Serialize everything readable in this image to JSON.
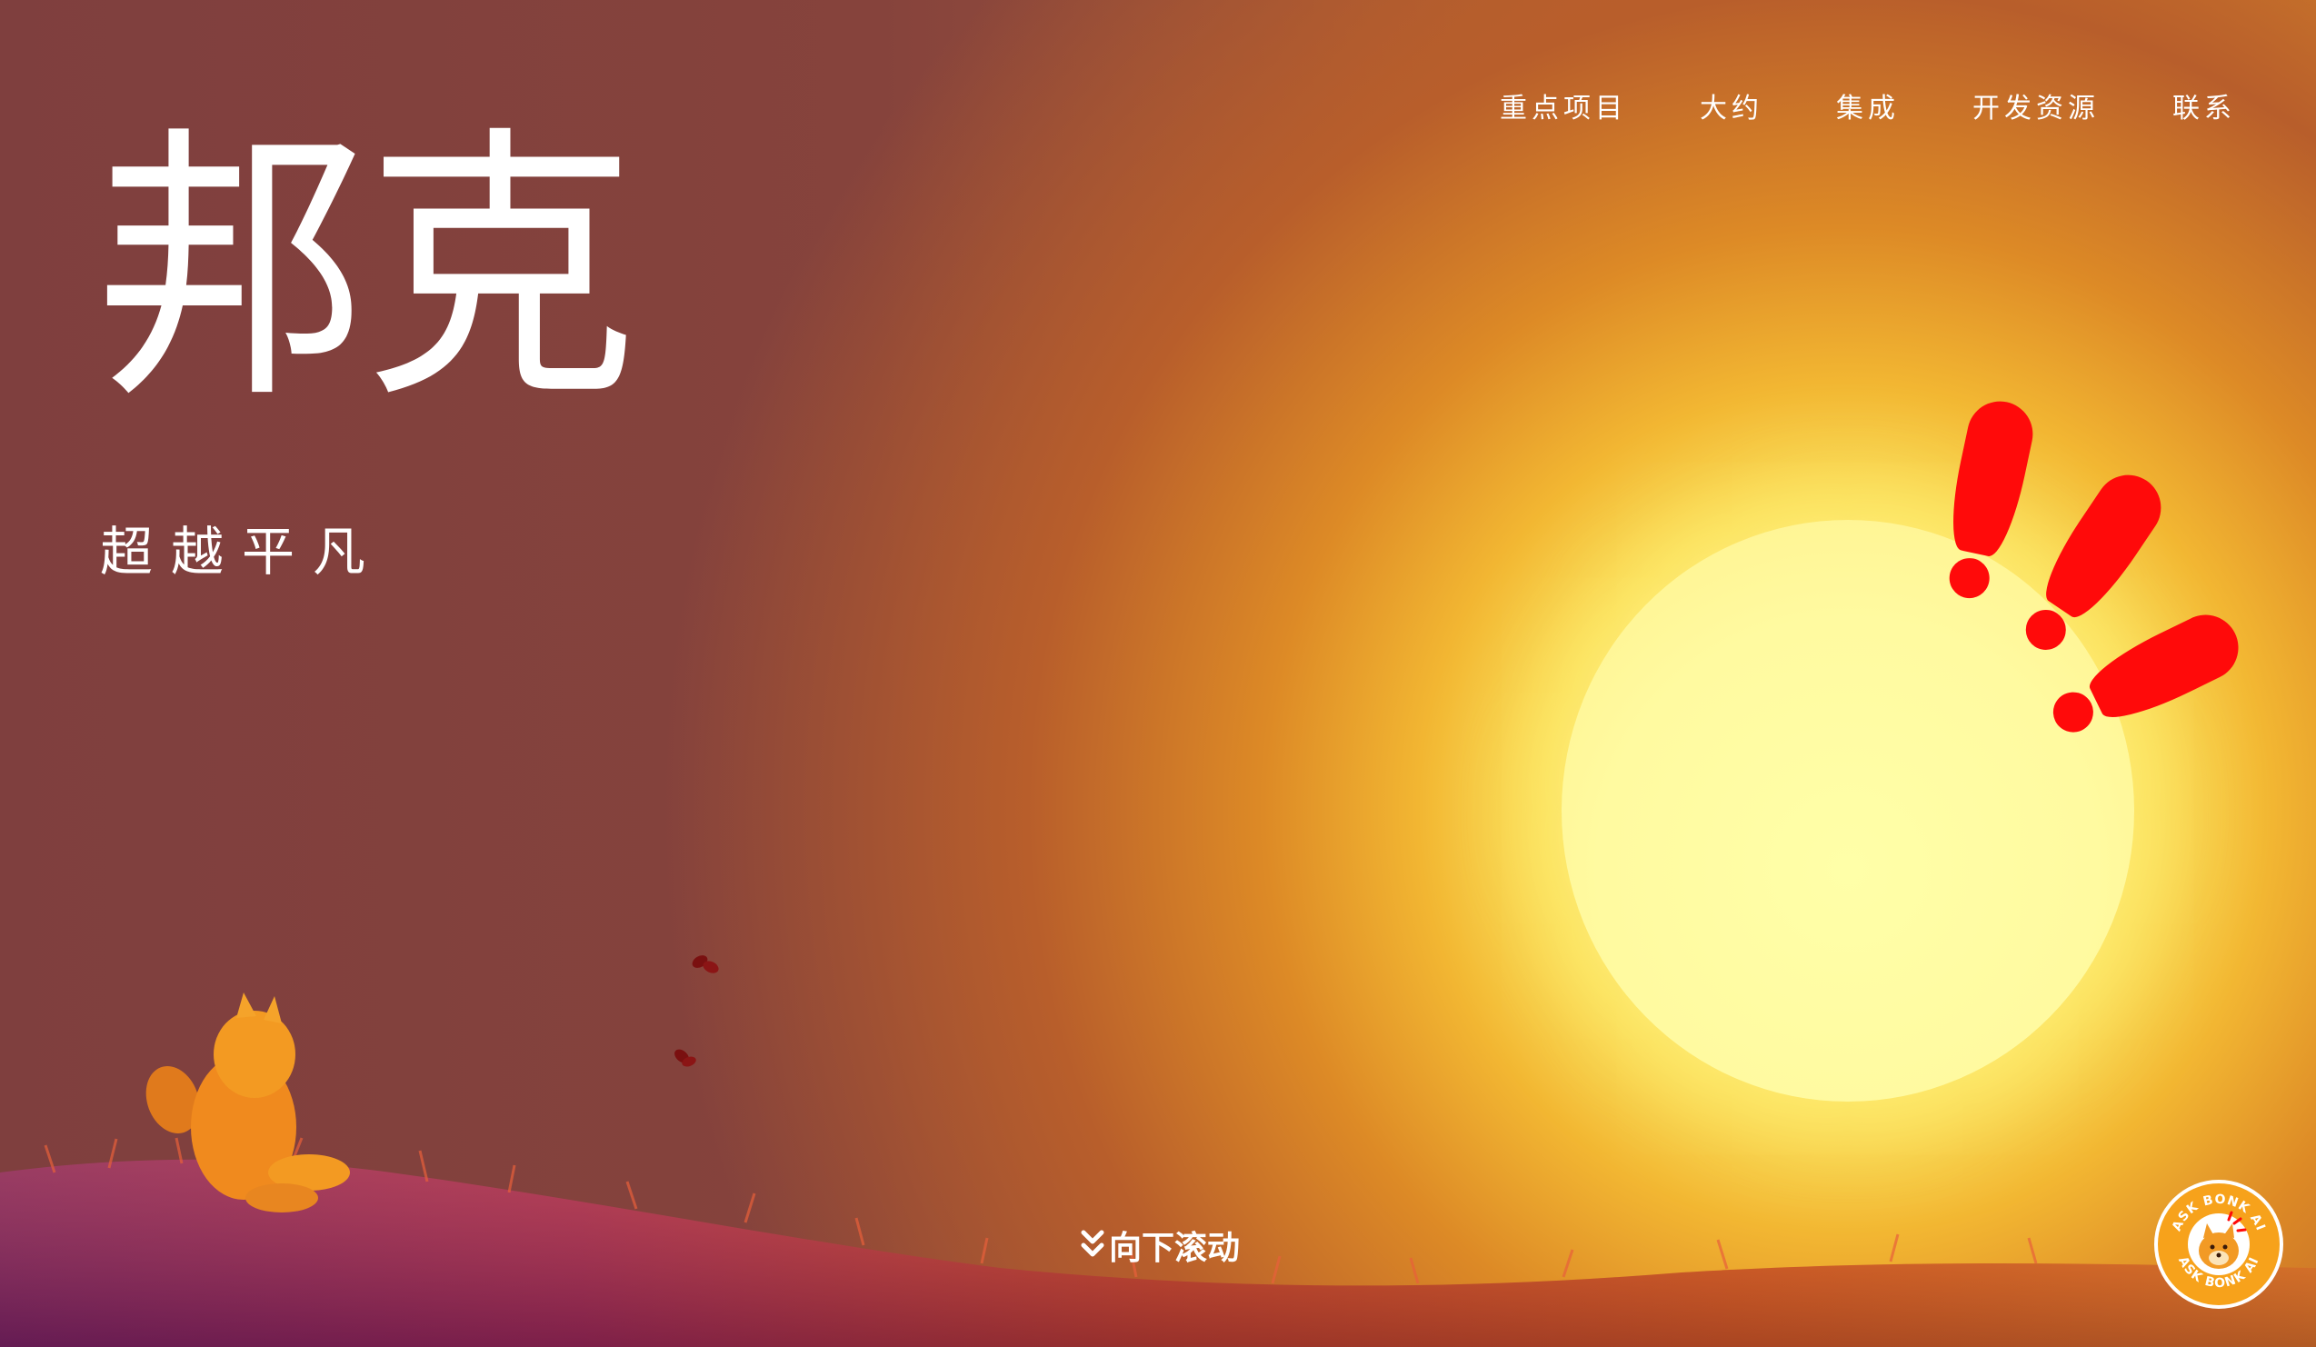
{
  "nav": {
    "items": [
      {
        "label": "重点项目"
      },
      {
        "label": "大约"
      },
      {
        "label": "集成"
      },
      {
        "label": "开发资源"
      },
      {
        "label": "联系"
      }
    ]
  },
  "hero": {
    "title": "邦克",
    "subtitle": "超越平凡"
  },
  "scroll_hint": {
    "label": "向下滚动",
    "icon": "double-chevron-down-icon"
  },
  "ask_badge": {
    "text_top": "ASK BONK AI",
    "text_bottom": "ASK BONK AI",
    "icon": "bonk-dog-icon"
  },
  "colors": {
    "accent_red": "#ff0a0a",
    "sun": "#fffaa0",
    "sky_left": "#7f3f3e",
    "sky_right": "#dc8f2a",
    "badge": "#f7a21b"
  }
}
